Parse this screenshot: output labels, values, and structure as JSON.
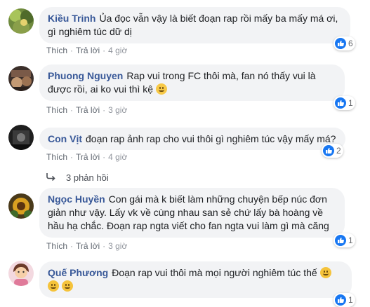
{
  "comments": [
    {
      "author": "Kiều Trinh",
      "text": "Ủa đọc vẫn vậy là biết đoạn rap rồi mấy ba mấy má ơi, gì nghiêm túc dữ dị",
      "like_label": "Thích",
      "reply_label": "Trả lời",
      "time": "4 giờ",
      "reaction_count": "6"
    },
    {
      "author": "Phuong Nguyen",
      "text": "Rap vui trong FC thôi mà, fan nó thấy vui là được rồi, ai ko vui thì kệ",
      "like_label": "Thích",
      "reply_label": "Trả lời",
      "time": "3 giờ",
      "reaction_count": "1"
    },
    {
      "author": "Con Vịt",
      "text": "đoạn rap ảnh rap cho vui thôi gì nghiêm túc vậy mấy má?",
      "like_label": "Thích",
      "reply_label": "Trả lời",
      "time": "4 giờ",
      "reaction_count": "2",
      "replies_label": "3 phản hồi"
    },
    {
      "author": "Ngọc Huyền",
      "text": "Con gái mà k biết làm những chuyện bếp núc đơn giản như vậy. Lấy vk về cùng nhau san sẻ chứ lấy bà hoàng về hầu hạ chắc. Đoạn rap ngta viết cho fan ngta vui làm gì mà căng",
      "like_label": "Thích",
      "reply_label": "Trả lời",
      "time": "3 giờ",
      "reaction_count": "1"
    },
    {
      "author": "Quế Phương",
      "text": "Đoạn rap vui thôi mà mọi người nghiêm túc thế",
      "reaction_count": "1"
    }
  ],
  "colors": {
    "author": "#385898",
    "bubble": "#f2f3f5",
    "like_blue": "#1877f2",
    "meta_gray": "#90949c"
  },
  "icons": [
    "avatar",
    "like-icon",
    "smile-emoji-icon",
    "reply-arrow-icon"
  ]
}
